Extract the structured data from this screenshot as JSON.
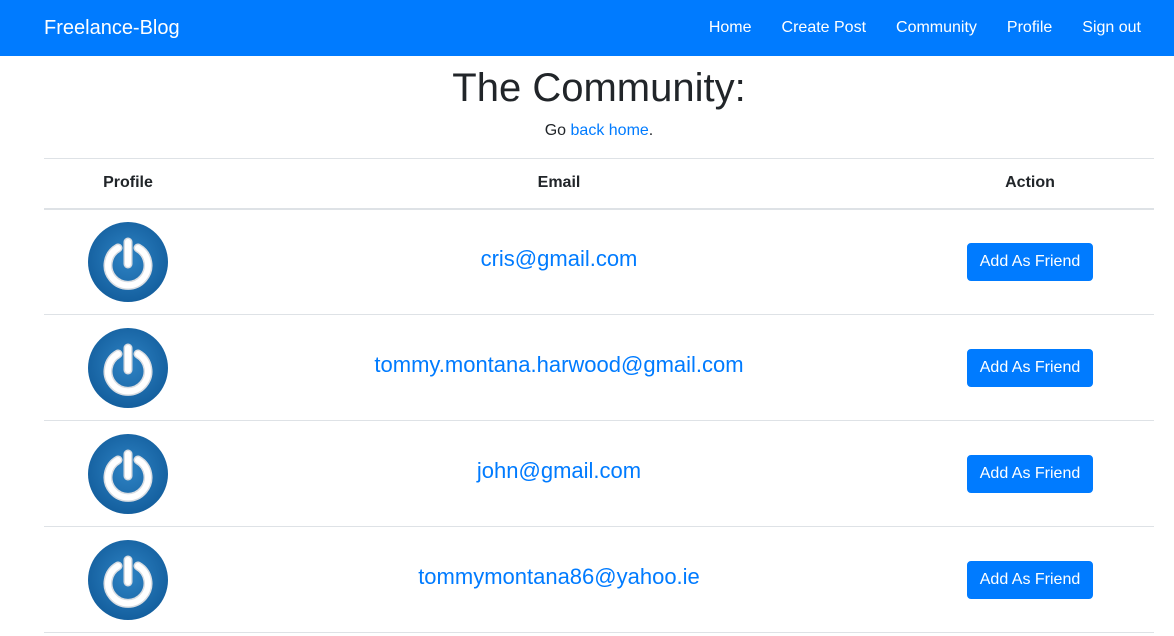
{
  "navbar": {
    "brand": "Freelance-Blog",
    "links": [
      "Home",
      "Create Post",
      "Community",
      "Profile",
      "Sign out"
    ],
    "color": "#007bff"
  },
  "page": {
    "title": "The Community:",
    "subtitle_prefix": "Go ",
    "subtitle_link": "back home",
    "subtitle_suffix": "."
  },
  "table": {
    "headers": [
      "Profile",
      "Email",
      "Action"
    ],
    "rows": [
      {
        "avatar_icon": "power-avatar-icon",
        "email": "cris@gmail.com",
        "action": "Add As Friend"
      },
      {
        "avatar_icon": "power-avatar-icon",
        "email": "tommy.montana.harwood@gmail.com",
        "action": "Add As Friend"
      },
      {
        "avatar_icon": "power-avatar-icon",
        "email": "john@gmail.com",
        "action": "Add As Friend"
      },
      {
        "avatar_icon": "power-avatar-icon",
        "email": "tommymontana86@yahoo.ie",
        "action": "Add As Friend"
      }
    ]
  },
  "colors": {
    "accent": "#007bff",
    "avatar_blue": "#1a6fb0"
  }
}
